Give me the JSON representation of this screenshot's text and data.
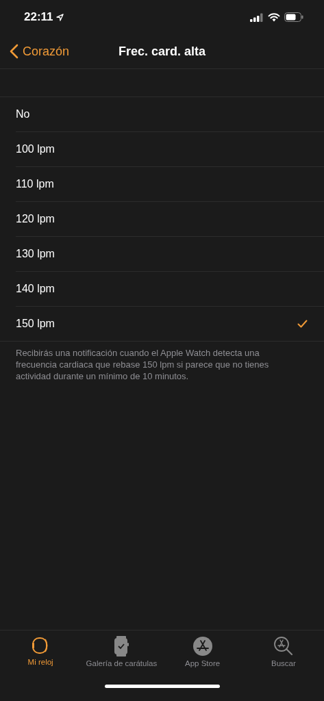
{
  "status_bar": {
    "time": "22:11"
  },
  "nav": {
    "back": "Corazón",
    "title": "Frec. card. alta"
  },
  "options": [
    {
      "label": "No",
      "selected": false
    },
    {
      "label": "100 lpm",
      "selected": false
    },
    {
      "label": "110 lpm",
      "selected": false
    },
    {
      "label": "120 lpm",
      "selected": false
    },
    {
      "label": "130 lpm",
      "selected": false
    },
    {
      "label": "140 lpm",
      "selected": false
    },
    {
      "label": "150 lpm",
      "selected": true
    }
  ],
  "footer": "Recibirás una notificación cuando el Apple Watch detecta una frecuencia cardiaca que rebase 150 lpm si parece que no tienes actividad durante un mínimo de 10 minutos.",
  "tabs": [
    {
      "label": "Mi reloj",
      "kind": "watch",
      "selected": true
    },
    {
      "label": "Galería de carátulas",
      "kind": "face",
      "selected": false
    },
    {
      "label": "App Store",
      "kind": "store",
      "selected": false
    },
    {
      "label": "Buscar",
      "kind": "search",
      "selected": false
    }
  ]
}
